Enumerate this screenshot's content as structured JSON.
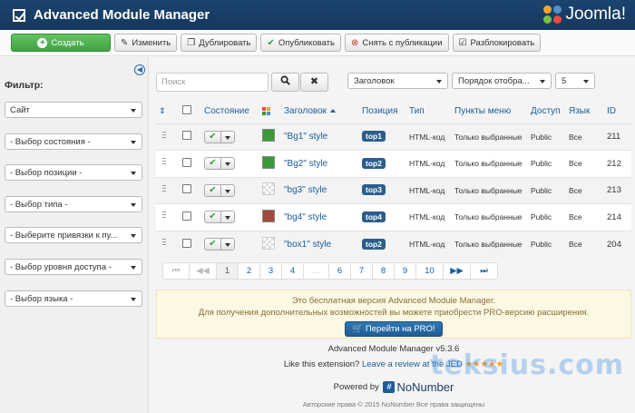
{
  "header": {
    "title": "Advanced Module Manager",
    "brand": "Joomla!"
  },
  "toolbar": {
    "create": "Создать",
    "edit": "Изменить",
    "duplicate": "Дублировать",
    "publish": "Опубликовать",
    "unpublish": "Снять с публикации",
    "unlock": "Разблокировать"
  },
  "sidebar": {
    "filter_label": "Фильтр:",
    "filters": [
      "Сайт",
      "- Выбор состояния -",
      "- Выбор позиции -",
      "- Выбор типа -",
      "- Выберите привязки к пу...",
      "- Выбор уровня доступа -",
      "- Выбор языка -"
    ]
  },
  "search": {
    "placeholder": "Поиск"
  },
  "list_controls": {
    "sort_field": "Заголовок",
    "sort_order": "Порядок отобра...",
    "limit": "5"
  },
  "table": {
    "headers": {
      "state": "Состояние",
      "title": "Заголовок",
      "position": "Позиция",
      "type": "Тип",
      "menu": "Пункты меню",
      "access": "Доступ",
      "language": "Язык",
      "id": "ID"
    },
    "rows": [
      {
        "color": "#3a9a3a",
        "title": "\"Bg1\" style",
        "position": "top1",
        "type": "HTML-код",
        "menu": "Только выбранные",
        "access": "Public",
        "language": "Все",
        "id": "211"
      },
      {
        "color": "#3a9a3a",
        "title": "\"Bg2\" style",
        "position": "top2",
        "type": "HTML-код",
        "menu": "Только выбранные",
        "access": "Public",
        "language": "Все",
        "id": "212"
      },
      {
        "color": "transparent",
        "title": "\"bg3\" style",
        "position": "top3",
        "type": "HTML-код",
        "menu": "Только выбранные",
        "access": "Public",
        "language": "Все",
        "id": "213"
      },
      {
        "color": "#a04a3c",
        "title": "\"bg4\" style",
        "position": "top4",
        "type": "HTML-код",
        "menu": "Только выбранные",
        "access": "Public",
        "language": "Все",
        "id": "214"
      },
      {
        "color": "transparent",
        "title": "\"box1\" style",
        "position": "top2",
        "type": "HTML-код",
        "menu": "Только выбранные",
        "access": "Public",
        "language": "Все",
        "id": "204"
      }
    ]
  },
  "pagination": {
    "pages": [
      "1",
      "2",
      "3",
      "4",
      "...",
      "6",
      "7",
      "8",
      "9",
      "10"
    ]
  },
  "notice": {
    "line1": "Это бесплатная версия Advanced Module Manager.",
    "line2": "Для получения дополнительных возможностей вы можете приобрести PRO-версию расширения.",
    "button": "Перейти на PRO!"
  },
  "footer": {
    "version": "Advanced Module Manager v5.3.6",
    "like_prefix": "Like this extension?",
    "review_link": "Leave a review at the JED",
    "stars": "★★★★★",
    "powered_by": "Powered by",
    "nonumber": "NoNumber",
    "copyright": "Авторские права © 2015 NoNumber Все права защищены"
  },
  "watermark": "teksius.com"
}
